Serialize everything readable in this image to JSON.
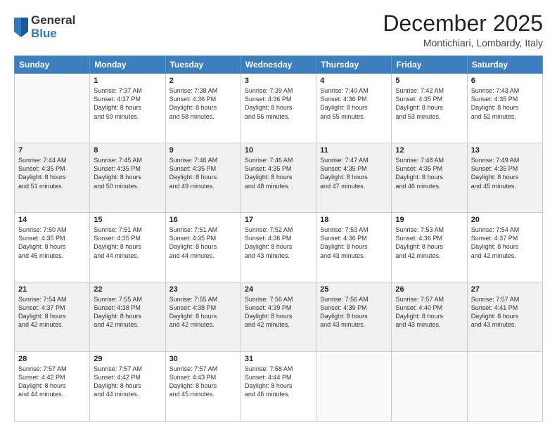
{
  "logo": {
    "general": "General",
    "blue": "Blue"
  },
  "title": "December 2025",
  "location": "Montichiari, Lombardy, Italy",
  "days_header": [
    "Sunday",
    "Monday",
    "Tuesday",
    "Wednesday",
    "Thursday",
    "Friday",
    "Saturday"
  ],
  "weeks": [
    [
      {
        "day": "",
        "info": ""
      },
      {
        "day": "1",
        "info": "Sunrise: 7:37 AM\nSunset: 4:37 PM\nDaylight: 8 hours\nand 59 minutes."
      },
      {
        "day": "2",
        "info": "Sunrise: 7:38 AM\nSunset: 4:36 PM\nDaylight: 8 hours\nand 58 minutes."
      },
      {
        "day": "3",
        "info": "Sunrise: 7:39 AM\nSunset: 4:36 PM\nDaylight: 8 hours\nand 56 minutes."
      },
      {
        "day": "4",
        "info": "Sunrise: 7:40 AM\nSunset: 4:36 PM\nDaylight: 8 hours\nand 55 minutes."
      },
      {
        "day": "5",
        "info": "Sunrise: 7:42 AM\nSunset: 4:35 PM\nDaylight: 8 hours\nand 53 minutes."
      },
      {
        "day": "6",
        "info": "Sunrise: 7:43 AM\nSunset: 4:35 PM\nDaylight: 8 hours\nand 52 minutes."
      }
    ],
    [
      {
        "day": "7",
        "info": "Sunrise: 7:44 AM\nSunset: 4:35 PM\nDaylight: 8 hours\nand 51 minutes."
      },
      {
        "day": "8",
        "info": "Sunrise: 7:45 AM\nSunset: 4:35 PM\nDaylight: 8 hours\nand 50 minutes."
      },
      {
        "day": "9",
        "info": "Sunrise: 7:46 AM\nSunset: 4:35 PM\nDaylight: 8 hours\nand 49 minutes."
      },
      {
        "day": "10",
        "info": "Sunrise: 7:46 AM\nSunset: 4:35 PM\nDaylight: 8 hours\nand 48 minutes."
      },
      {
        "day": "11",
        "info": "Sunrise: 7:47 AM\nSunset: 4:35 PM\nDaylight: 8 hours\nand 47 minutes."
      },
      {
        "day": "12",
        "info": "Sunrise: 7:48 AM\nSunset: 4:35 PM\nDaylight: 8 hours\nand 46 minutes."
      },
      {
        "day": "13",
        "info": "Sunrise: 7:49 AM\nSunset: 4:35 PM\nDaylight: 8 hours\nand 45 minutes."
      }
    ],
    [
      {
        "day": "14",
        "info": "Sunrise: 7:50 AM\nSunset: 4:35 PM\nDaylight: 8 hours\nand 45 minutes."
      },
      {
        "day": "15",
        "info": "Sunrise: 7:51 AM\nSunset: 4:35 PM\nDaylight: 8 hours\nand 44 minutes."
      },
      {
        "day": "16",
        "info": "Sunrise: 7:51 AM\nSunset: 4:35 PM\nDaylight: 8 hours\nand 44 minutes."
      },
      {
        "day": "17",
        "info": "Sunrise: 7:52 AM\nSunset: 4:36 PM\nDaylight: 8 hours\nand 43 minutes."
      },
      {
        "day": "18",
        "info": "Sunrise: 7:53 AM\nSunset: 4:36 PM\nDaylight: 8 hours\nand 43 minutes."
      },
      {
        "day": "19",
        "info": "Sunrise: 7:53 AM\nSunset: 4:36 PM\nDaylight: 8 hours\nand 42 minutes."
      },
      {
        "day": "20",
        "info": "Sunrise: 7:54 AM\nSunset: 4:37 PM\nDaylight: 8 hours\nand 42 minutes."
      }
    ],
    [
      {
        "day": "21",
        "info": "Sunrise: 7:54 AM\nSunset: 4:37 PM\nDaylight: 8 hours\nand 42 minutes."
      },
      {
        "day": "22",
        "info": "Sunrise: 7:55 AM\nSunset: 4:38 PM\nDaylight: 8 hours\nand 42 minutes."
      },
      {
        "day": "23",
        "info": "Sunrise: 7:55 AM\nSunset: 4:38 PM\nDaylight: 8 hours\nand 42 minutes."
      },
      {
        "day": "24",
        "info": "Sunrise: 7:56 AM\nSunset: 4:39 PM\nDaylight: 8 hours\nand 42 minutes."
      },
      {
        "day": "25",
        "info": "Sunrise: 7:56 AM\nSunset: 4:39 PM\nDaylight: 8 hours\nand 43 minutes."
      },
      {
        "day": "26",
        "info": "Sunrise: 7:57 AM\nSunset: 4:40 PM\nDaylight: 8 hours\nand 43 minutes."
      },
      {
        "day": "27",
        "info": "Sunrise: 7:57 AM\nSunset: 4:41 PM\nDaylight: 8 hours\nand 43 minutes."
      }
    ],
    [
      {
        "day": "28",
        "info": "Sunrise: 7:57 AM\nSunset: 4:42 PM\nDaylight: 8 hours\nand 44 minutes."
      },
      {
        "day": "29",
        "info": "Sunrise: 7:57 AM\nSunset: 4:42 PM\nDaylight: 8 hours\nand 44 minutes."
      },
      {
        "day": "30",
        "info": "Sunrise: 7:57 AM\nSunset: 4:43 PM\nDaylight: 8 hours\nand 45 minutes."
      },
      {
        "day": "31",
        "info": "Sunrise: 7:58 AM\nSunset: 4:44 PM\nDaylight: 8 hours\nand 46 minutes."
      },
      {
        "day": "",
        "info": ""
      },
      {
        "day": "",
        "info": ""
      },
      {
        "day": "",
        "info": ""
      }
    ]
  ]
}
